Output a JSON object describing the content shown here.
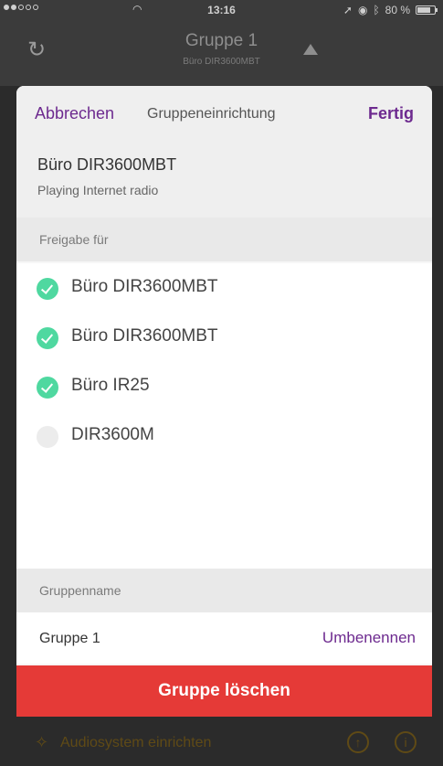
{
  "status_bar": {
    "time": "13:16",
    "battery": "80 %",
    "battery_level": 0.8
  },
  "app_header": {
    "title": "Gruppe 1",
    "subtitle": "Büro DIR3600MBT"
  },
  "sheet": {
    "cancel_label": "Abbrechen",
    "title": "Gruppeneinrichtung",
    "done_label": "Fertig",
    "device_name": "Büro DIR3600MBT",
    "device_status": "Playing Internet radio",
    "share_section_label": "Freigabe für",
    "share_items": [
      {
        "label": "Büro DIR3600MBT",
        "checked": true
      },
      {
        "label": "Büro DIR3600MBT",
        "checked": true
      },
      {
        "label": "Büro IR25",
        "checked": true
      },
      {
        "label": "DIR3600M",
        "checked": false
      }
    ],
    "group_name_section_label": "Gruppenname",
    "group_name_value": "Gruppe 1",
    "rename_label": "Umbenennen",
    "delete_label": "Gruppe löschen"
  },
  "bottom_bar": {
    "setup_label": "Audiosystem einrichten",
    "upload_icon": "↑",
    "info_icon": "i"
  },
  "colors": {
    "accent": "#6d2a8f",
    "check_on": "#4fd8a0",
    "delete": "#e53a37"
  }
}
